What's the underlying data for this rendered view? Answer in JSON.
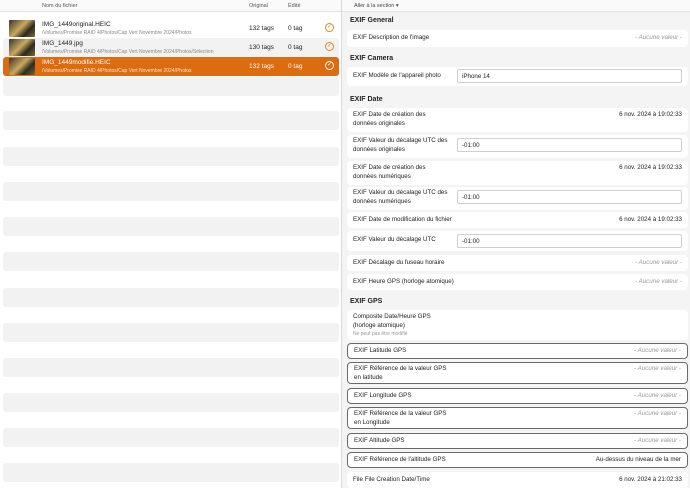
{
  "file_list": {
    "headers": {
      "name": "Nom du fichier",
      "original": "Original",
      "edited": "Édité"
    },
    "files": [
      {
        "name": "IMG_1449original.HEIC",
        "path": "/Volumes/Promise RAID 4/Photos/Cap Vert Novembre 2024/Photos",
        "original": "132 tags",
        "edited": "0 tag"
      },
      {
        "name": "IMG_1449.jpg",
        "path": "/Volumes/Promise RAID 4/Photos/Cap Vert Novembre 2024/Photos/Sélection",
        "original": "130 tags",
        "edited": "0 tag"
      },
      {
        "name": "IMG_1449modifié.HEIC",
        "path": "/Volumes/Promise RAID 4/Photos/Cap Vert Novembre 2024/Photos",
        "original": "132 tags",
        "edited": "0 tag"
      }
    ],
    "check_glyph": "✓",
    "selected_color": "#dd6b10"
  },
  "inspector": {
    "goto_section": "Aller à la section ▾",
    "placeholder": "- Aucune valeur -",
    "sections": {
      "general": "EXIF General",
      "camera": "EXIF Camera",
      "date": "EXIF Date",
      "gps": "EXIF GPS"
    },
    "fields": {
      "description": "EXIF Description de l'image",
      "model": "EXIF Modèle de l'appareil photo",
      "model_value": "iPhone 14",
      "date_orig": "EXIF Date de création des données originales",
      "date_orig_value": "6 nov. 2024 à 19:02:33",
      "utc_orig": "EXIF Valeur du décalage UTC des données originales",
      "utc_orig_value": "-01:00",
      "date_num": "EXIF Date de création des données numériques",
      "date_num_value": "6 nov. 2024 à 19:02:33",
      "utc_num": "EXIF Valeur du décalage UTC des données numériques",
      "utc_num_value": "-01:00",
      "date_mod": "EXIF Date de modification du fichier",
      "date_mod_value": "6 nov. 2024 à 19:02:33",
      "utc": "EXIF Valeur du décalage UTC",
      "utc_value": "-01:00",
      "tz": "EXIF Décalage du fuseau horaire",
      "gps_time": "EXIF Heure GPS (horloge atomique)",
      "composite": "Composite Date/Heure GPS (horloge atomique)",
      "composite_note": "Ne peut pas être modifié",
      "lat": "EXIF Latitude GPS",
      "lat_ref": "EXIF Référence de la valeur GPS en latitude",
      "lon": "EXIF Longitude GPS",
      "lon_ref": "EXIF Référence de la valeur GPS en Longitude",
      "alt": "EXIF Altitude GPS",
      "alt_ref": "EXIF Référence de l'altitude GPS",
      "alt_ref_value": "Au-dessus du niveau de la mer",
      "file_creation": "File File Creation Date/Time",
      "file_creation_value": "6 nov. 2024 à 21:02:33"
    }
  }
}
